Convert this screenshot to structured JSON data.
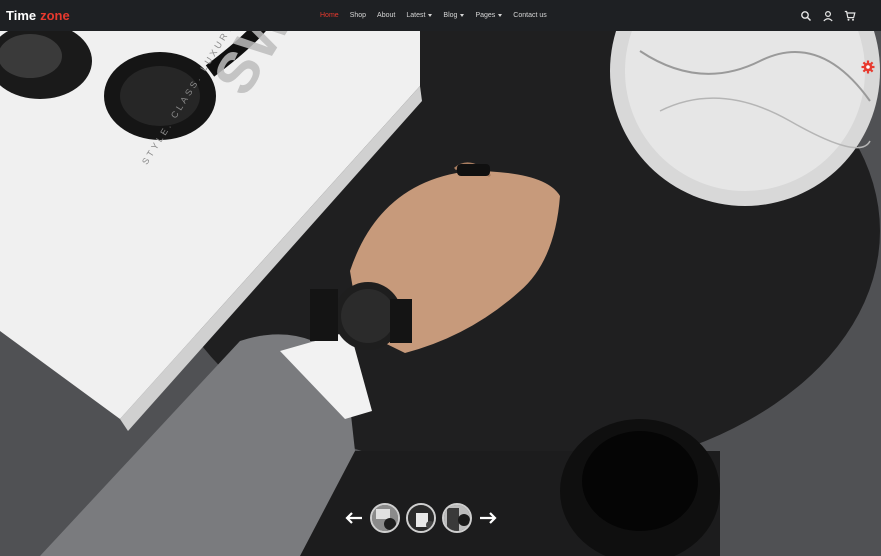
{
  "brand": {
    "name_part1": "Time",
    "name_part2": "zone",
    "accent_color": "#e8392e"
  },
  "nav": {
    "items": [
      {
        "label": "Home",
        "active": true,
        "dropdown": false
      },
      {
        "label": "Shop",
        "active": false,
        "dropdown": false
      },
      {
        "label": "About",
        "active": false,
        "dropdown": false
      },
      {
        "label": "Latest",
        "active": false,
        "dropdown": true
      },
      {
        "label": "Blog",
        "active": false,
        "dropdown": true
      },
      {
        "label": "Pages",
        "active": false,
        "dropdown": true
      },
      {
        "label": "Contact us",
        "active": false,
        "dropdown": false
      }
    ]
  },
  "header_icons": [
    "search-icon",
    "user-icon",
    "cart-icon"
  ],
  "hero": {
    "magazine_title": "SWAGGER",
    "magazine_tagline": "STYLE. CLASS. LUXURY."
  },
  "slider": {
    "thumbnail_count": 3,
    "prev_icon": "arrow-left-icon",
    "next_icon": "arrow-right-icon"
  },
  "settings": {
    "icon": "gear-icon",
    "color": "#e8392e"
  }
}
